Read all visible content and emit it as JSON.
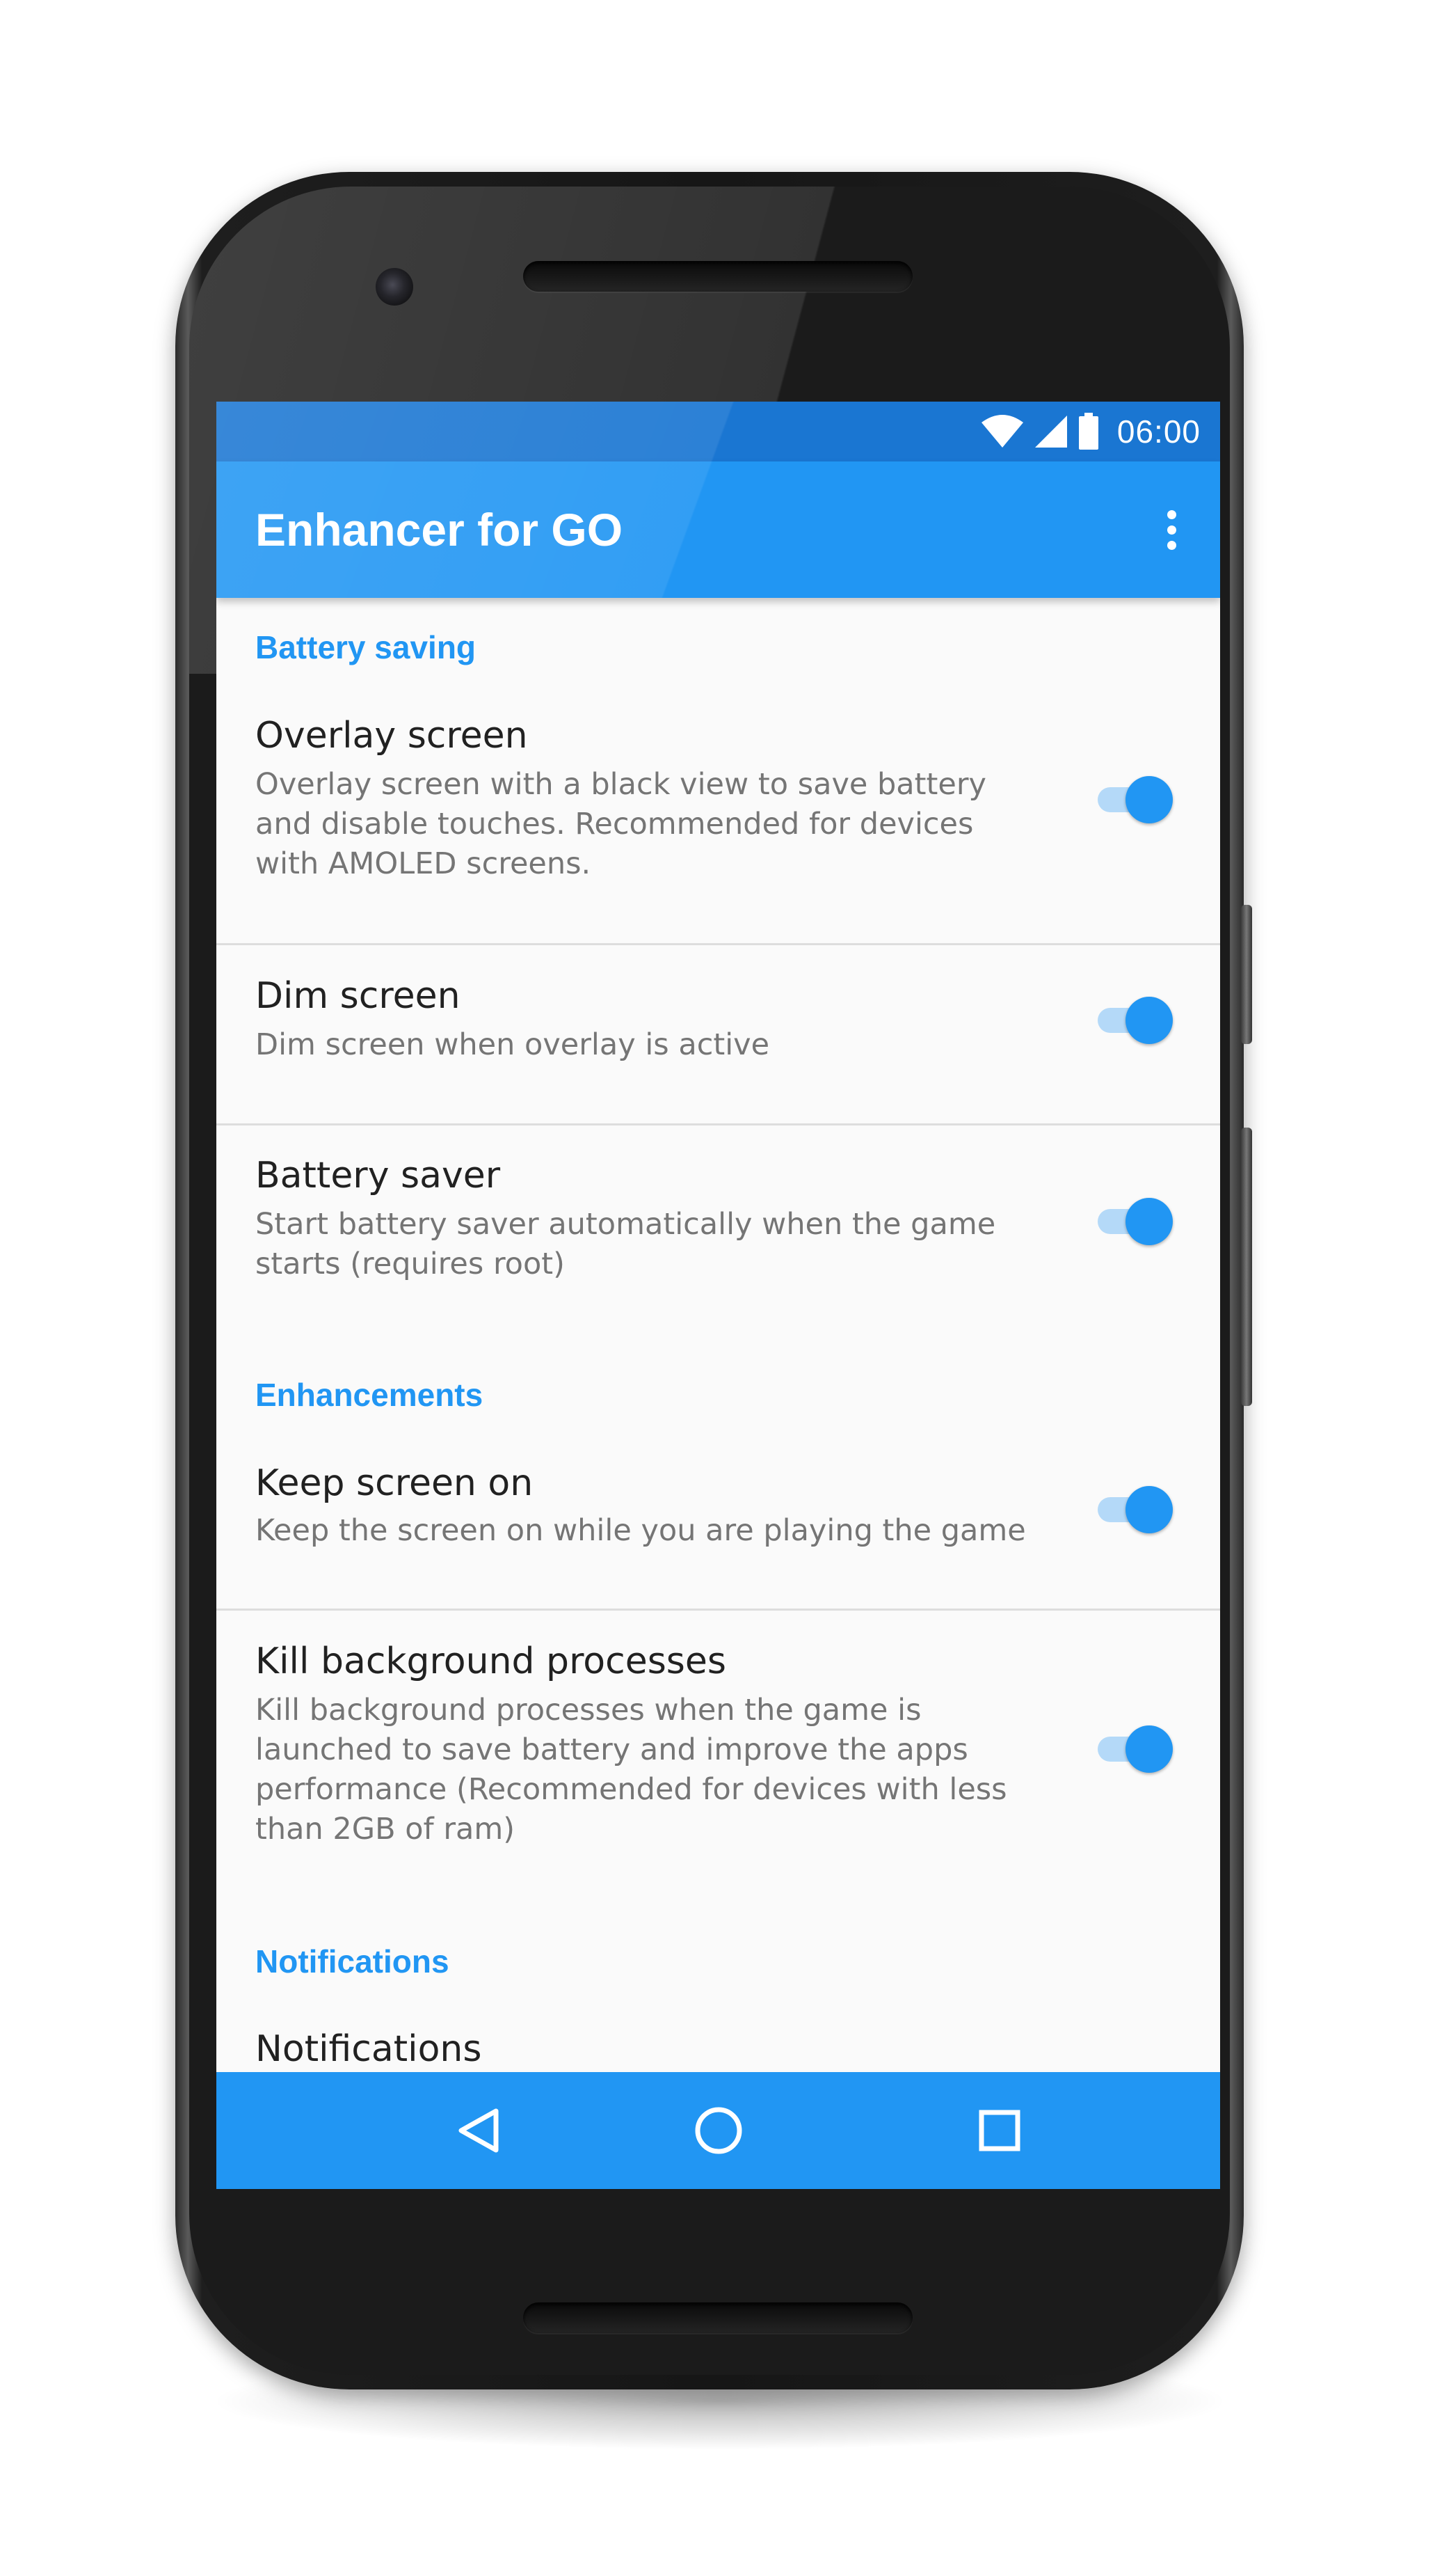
{
  "status_bar": {
    "time": "06:00",
    "icons": [
      "wifi-icon",
      "cell-signal-icon",
      "battery-icon"
    ]
  },
  "app_bar": {
    "title": "Enhancer for GO",
    "menu_icon": "more-vert-icon"
  },
  "sections": {
    "battery_saving": {
      "header": "Battery saving",
      "overlay_screen": {
        "title": "Overlay screen",
        "summary": "Overlay screen with a black view to save battery and disable touches. Recommended for devices with AMOLED screens.",
        "enabled": true
      },
      "dim_screen": {
        "title": "Dim screen",
        "summary": "Dim screen when overlay is active",
        "enabled": true
      },
      "battery_saver": {
        "title": "Battery saver",
        "summary": "Start battery saver automatically when the game starts (requires root)",
        "enabled": true
      }
    },
    "enhancements": {
      "header": "Enhancements",
      "keep_screen_on": {
        "title": "Keep screen on",
        "summary": "Keep the screen on while you are playing the game",
        "enabled": true
      },
      "kill_background": {
        "title": "Kill background processes",
        "summary": "Kill background processes when the game is launched to save battery and improve the apps performance (Recommended for devices with less than 2GB of ram)",
        "enabled": true
      }
    },
    "notifications": {
      "header": "Notifications",
      "notifications_item": {
        "title": "Notifications"
      }
    }
  },
  "nav_bar": {
    "icons": [
      "back-icon",
      "home-icon",
      "recents-icon"
    ]
  },
  "colors": {
    "primary": "#2196f3",
    "primary_dark": "#1a76d2",
    "switch_track_on": "#b4d9f8",
    "background": "#fafafa",
    "title_text": "#212121",
    "summary_text": "#757575"
  }
}
